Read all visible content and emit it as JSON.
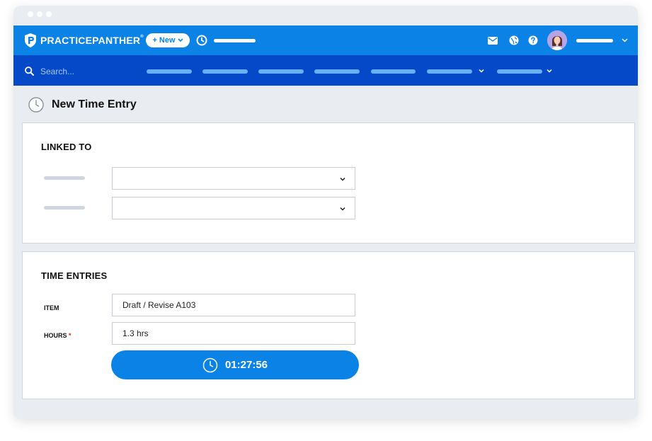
{
  "topbar": {
    "brand": "PRACTICEPANTHER",
    "brand_mark": "®",
    "new_button": "+ New",
    "colors": {
      "brand_blue": "#0b83e6",
      "nav_blue": "#0549c8"
    }
  },
  "navbar": {
    "search_placeholder": "Search..."
  },
  "page": {
    "title": "New Time Entry"
  },
  "linked_to": {
    "title": "LINKED TO"
  },
  "time_entries": {
    "title": "TIME ENTRIES",
    "item_label": "ITEM",
    "item_value": "Draft / Revise A103",
    "hours_label": "HOURS",
    "hours_required": "*",
    "hours_value": "1.3 hrs",
    "timer": "01:27:56"
  }
}
